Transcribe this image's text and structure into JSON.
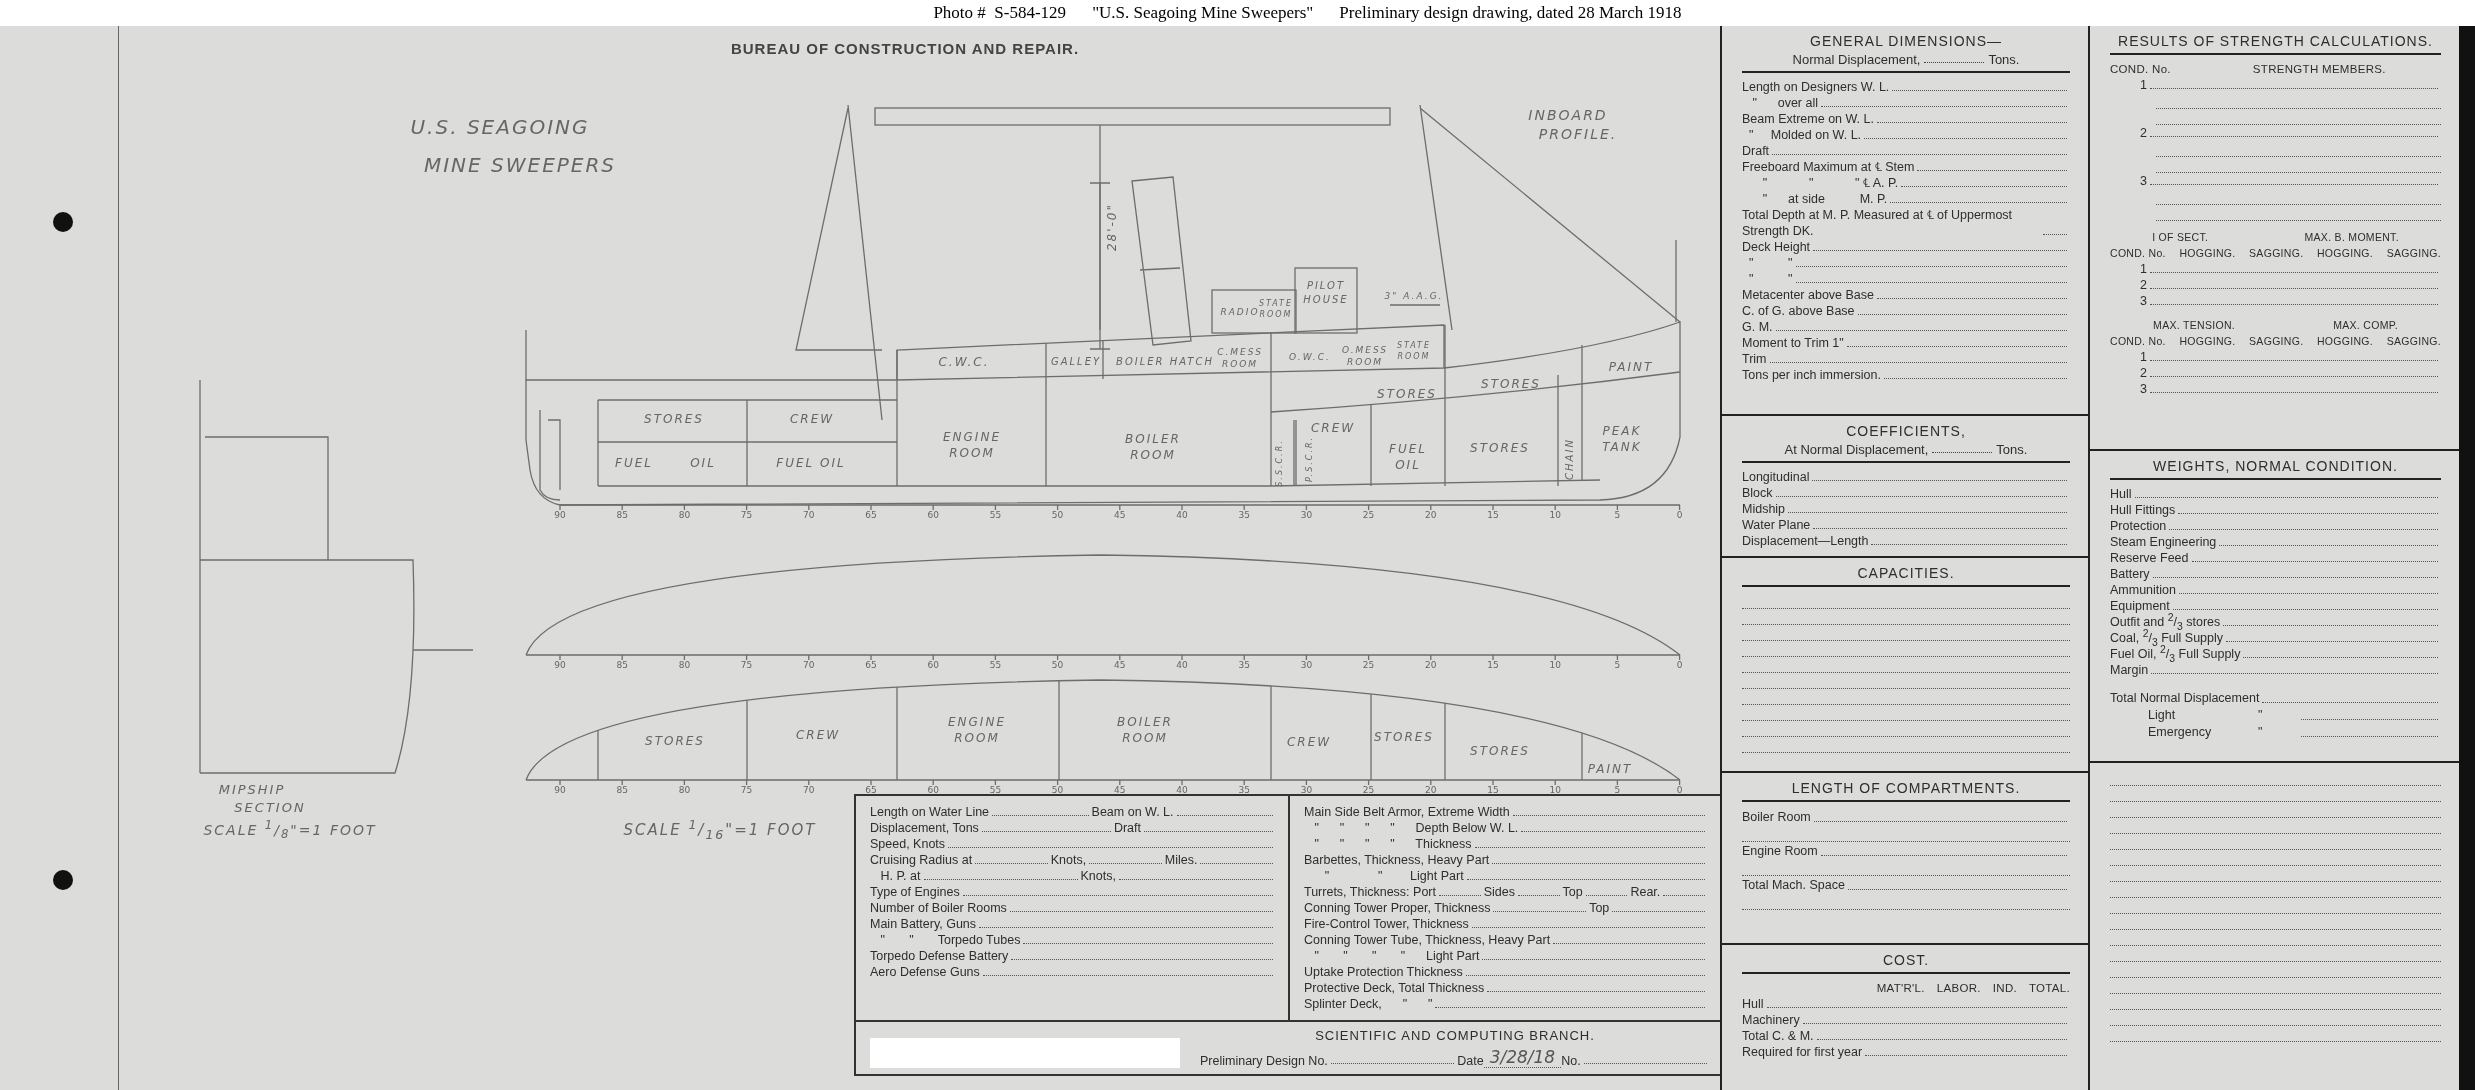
{
  "caption": {
    "photo_no": "Photo #  S-584-129",
    "title": "\"U.S. Seagoing Mine Sweepers\"",
    "description": "Preliminary design drawing, dated 28 March 1918"
  },
  "drawing": {
    "bureau": "BUREAU OF CONSTRUCTION AND REPAIR.",
    "title_lines": [
      "U.S. SEAGOING",
      "MINE SWEEPERS"
    ],
    "view_title_lines": [
      "INBOARD",
      "PROFILE."
    ],
    "profile_labels": [
      "STORES",
      "CREW",
      "FUEL",
      "OIL",
      "FUEL OIL",
      "ENGINE ROOM",
      "BOILER ROOM",
      "C.W.C.",
      "GALLEY",
      "BOILER HATCH",
      "C.MESS ROOM",
      "O.W.C.",
      "O.MESS ROOM",
      "STATE ROOM",
      "RADIO",
      "STATE ROOM",
      "PILOT HOUSE",
      "3\" A.A.G.",
      "CREW",
      "STORES",
      "STORES",
      "PAINT",
      "FUEL OIL",
      "STORES",
      "CHAIN",
      "PEAK TANK",
      "S.S.C.R.",
      "P.S.C.R."
    ],
    "dimension": "28'-0\"",
    "plan_labels": [
      "STORES",
      "CREW",
      "ENGINE ROOM",
      "BOILER ROOM",
      "CREW",
      "STORES",
      "STORES",
      "PAINT"
    ],
    "frame_scales": [
      [
        "90",
        "85",
        "80",
        "75",
        "70",
        "65",
        "60",
        "55",
        "50",
        "45",
        "40",
        "35",
        "30",
        "25",
        "20",
        "15",
        "10",
        "5",
        "0"
      ],
      [
        "90",
        "85",
        "80",
        "75",
        "70",
        "65",
        "60",
        "55",
        "50",
        "45",
        "40",
        "35",
        "30",
        "25",
        "20",
        "15",
        "10",
        "5",
        "0"
      ],
      [
        "90",
        "85",
        "80",
        "75",
        "70",
        "65",
        "60",
        "55",
        "50",
        "45",
        "40",
        "35",
        "30",
        "25",
        "20",
        "15",
        "10",
        "5",
        "0"
      ]
    ],
    "midship_lines": [
      "MIPSHIP",
      "SECTION"
    ],
    "midship_scale": "SCALE $^{1}$/$_{8}$\"=1 FOOT",
    "profile_scale": "SCALE $^{1}$/$_{16}$\"=1 FOOT"
  },
  "specs": {
    "left_rows": [
      {
        "parts": [
          "Length on Water Line",
          "Beam on W. L."
        ]
      },
      {
        "parts": [
          "Displacement, Tons",
          "Draft"
        ]
      },
      {
        "parts": [
          "Speed, Knots"
        ]
      },
      {
        "parts": [
          "Cruising Radius at",
          "Knots,",
          "Miles."
        ]
      },
      {
        "parts": [
          "   H. P. at",
          "Knots,"
        ]
      },
      {
        "parts": [
          "Type of Engines"
        ]
      },
      {
        "parts": [
          "Number of Boiler Rooms"
        ]
      },
      {
        "parts": [
          "Main Battery, Guns"
        ]
      },
      {
        "parts": [
          "   \"       \"       Torpedo Tubes"
        ]
      },
      {
        "parts": [
          "Torpedo Defense Battery"
        ]
      },
      {
        "parts": [
          "Aero Defense Guns"
        ]
      }
    ],
    "right_rows": [
      {
        "parts": [
          "Main Side Belt Armor, Extreme Width"
        ]
      },
      {
        "parts": [
          "   \"      \"      \"      \"      Depth Below W. L."
        ]
      },
      {
        "parts": [
          "   \"      \"      \"      \"      Thickness"
        ]
      },
      {
        "parts": [
          "Barbettes, Thickness, Heavy Part"
        ]
      },
      {
        "parts": [
          "      \"              \"        Light Part"
        ]
      },
      {
        "parts": [
          "Turrets, Thickness: Port",
          "Sides",
          "Top",
          "Rear."
        ]
      },
      {
        "parts": [
          "Conning Tower Proper, Thickness",
          "Top"
        ]
      },
      {
        "parts": [
          "Fire-Control Tower, Thickness"
        ]
      },
      {
        "parts": [
          "Conning Tower Tube, Thickness, Heavy Part"
        ]
      },
      {
        "parts": [
          "   \"       \"       \"       \"      Light Part"
        ]
      },
      {
        "parts": [
          "Uptake Protection Thickness"
        ]
      },
      {
        "parts": [
          "Protective Deck, Total Thickness"
        ]
      },
      {
        "parts": [
          "Splinter Deck,      \"      \""
        ]
      }
    ],
    "branch": "SCIENTIFIC AND COMPUTING BRANCH.",
    "fields": [
      {
        "label": "Preliminary Design No."
      },
      {
        "label": "Date",
        "value": "3/28/18"
      },
      {
        "label": "No."
      }
    ]
  },
  "general_dimensions": {
    "title": "GENERAL DIMENSIONS—",
    "subtitle": [
      "Normal Displacement,",
      "Tons."
    ],
    "rows": [
      "Length on Designers W. L.",
      "   \"      over all",
      "Beam Extreme on W. L.",
      "  \"     Molded on W. L.",
      "Draft",
      "Freeboard Maximum at ℄ Stem",
      "      \"            \"            \" ℄ A. P.",
      "      \"      at side          M. P.",
      "Total Depth at M. P. Measured at ℄ of Uppermost Strength DK.",
      "Deck Height",
      "  \"          \"",
      "  \"          \"",
      "Metacenter above Base",
      "C. of G. above Base",
      "G. M.",
      "Moment to Trim 1\"",
      "Trim",
      "Tons per inch immersion."
    ]
  },
  "coefficients": {
    "title": "COEFFICIENTS,",
    "subtitle": [
      "At Normal Displacement,",
      "Tons."
    ],
    "rows": [
      "Longitudinal",
      "Block",
      "Midship",
      "Water Plane",
      "Displacement—Length"
    ]
  },
  "capacities": {
    "title": "CAPACITIES."
  },
  "compartments": {
    "title": "LENGTH OF COMPARTMENTS.",
    "rows": [
      "Boiler Room",
      "Engine Room",
      "Total Mach. Space"
    ]
  },
  "cost": {
    "title": "COST.",
    "columns": [
      "MAT'R'L.",
      "LABOR.",
      "IND.",
      "TOTAL."
    ],
    "rows": [
      "Hull",
      "Machinery",
      "Total C. & M.",
      "Required for first year"
    ]
  },
  "strength": {
    "title": "RESULTS OF STRENGTH CALCULATIONS.",
    "members_header": [
      "COND. No.",
      "STRENGTH MEMBERS."
    ],
    "member_conditions": [
      "1",
      "2",
      "3"
    ],
    "tables": [
      {
        "group_headers": [
          "I OF SECT.",
          "MAX. B. MOMENT."
        ],
        "columns": [
          "COND. No.",
          "HOGGING.",
          "SAGGING.",
          "HOGGING.",
          "SAGGING."
        ],
        "conditions": [
          "1",
          "2",
          "3"
        ]
      },
      {
        "group_headers": [
          "MAX. TENSION.",
          "MAX. COMP."
        ],
        "columns": [
          "COND. No.",
          "HOGGING.",
          "SAGGING.",
          "HOGGING.",
          "SAGGING."
        ],
        "conditions": [
          "1",
          "2",
          "3"
        ]
      }
    ]
  },
  "weights": {
    "title": "WEIGHTS, NORMAL CONDITION.",
    "rows": [
      "Hull",
      "Hull Fittings",
      "Protection",
      "Steam Engineering",
      "Reserve Feed",
      "Battery",
      "Ammunition",
      "Equipment",
      "Outfit and $^{2}$/$_{3}$ stores",
      "Coal, $^{2}$/$_{3}$ Full Supply",
      "Fuel Oil, $^{2}$/$_{3}$ Full Supply",
      "Margin"
    ],
    "totals": [
      {
        "label": "Total Normal Displacement"
      },
      {
        "label": "Light",
        "ditto": "\""
      },
      {
        "label": "Emergency",
        "ditto": "\""
      }
    ]
  }
}
